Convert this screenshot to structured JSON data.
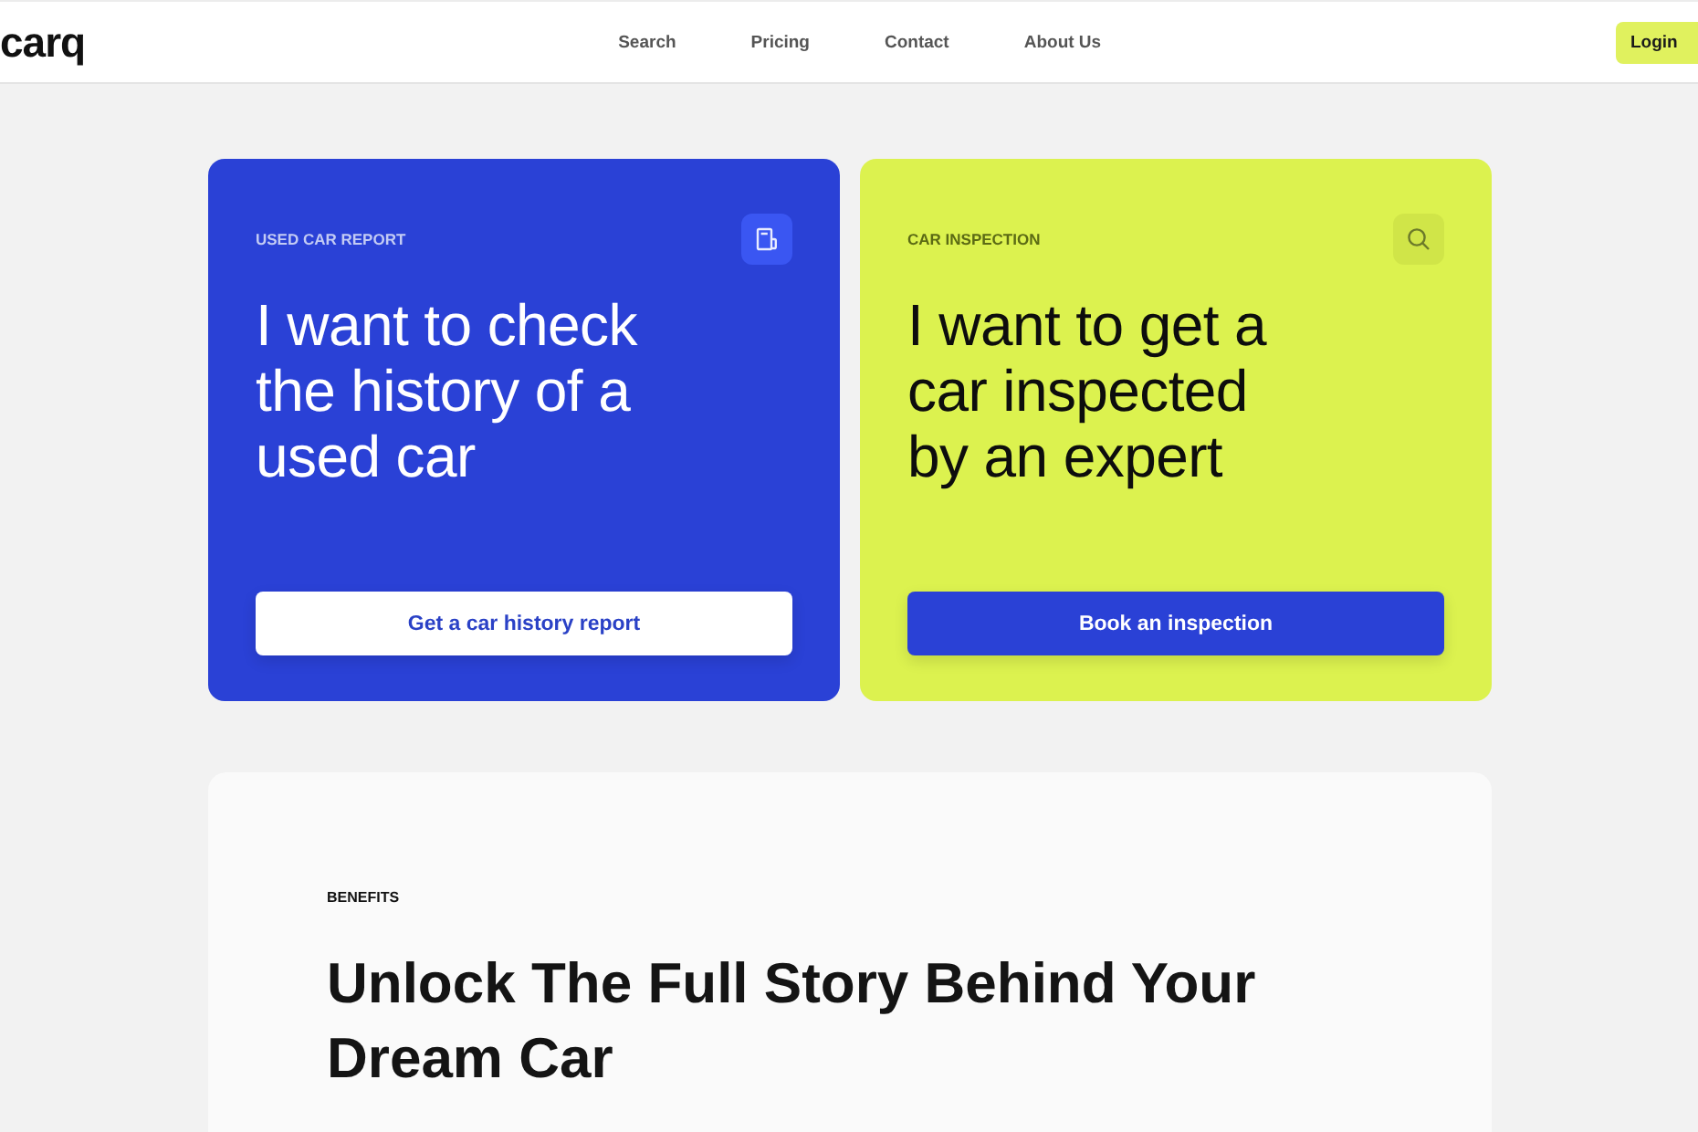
{
  "header": {
    "logo": "carq",
    "nav": [
      {
        "label": "Search"
      },
      {
        "label": "Pricing"
      },
      {
        "label": "Contact"
      },
      {
        "label": "About Us"
      }
    ],
    "login": "Login"
  },
  "cards": [
    {
      "kind": "report",
      "label": "USED CAR REPORT",
      "heading": "I want to check the history of a used car",
      "button": "Get a car history report"
    },
    {
      "kind": "inspection",
      "label": "CAR INSPECTION",
      "heading": "I want to get a car inspected by an expert",
      "button": "Book an inspection"
    }
  ],
  "benefits": {
    "eyebrow": "BENEFITS",
    "heading": "Unlock The Full Story Behind Your Dream Car"
  }
}
